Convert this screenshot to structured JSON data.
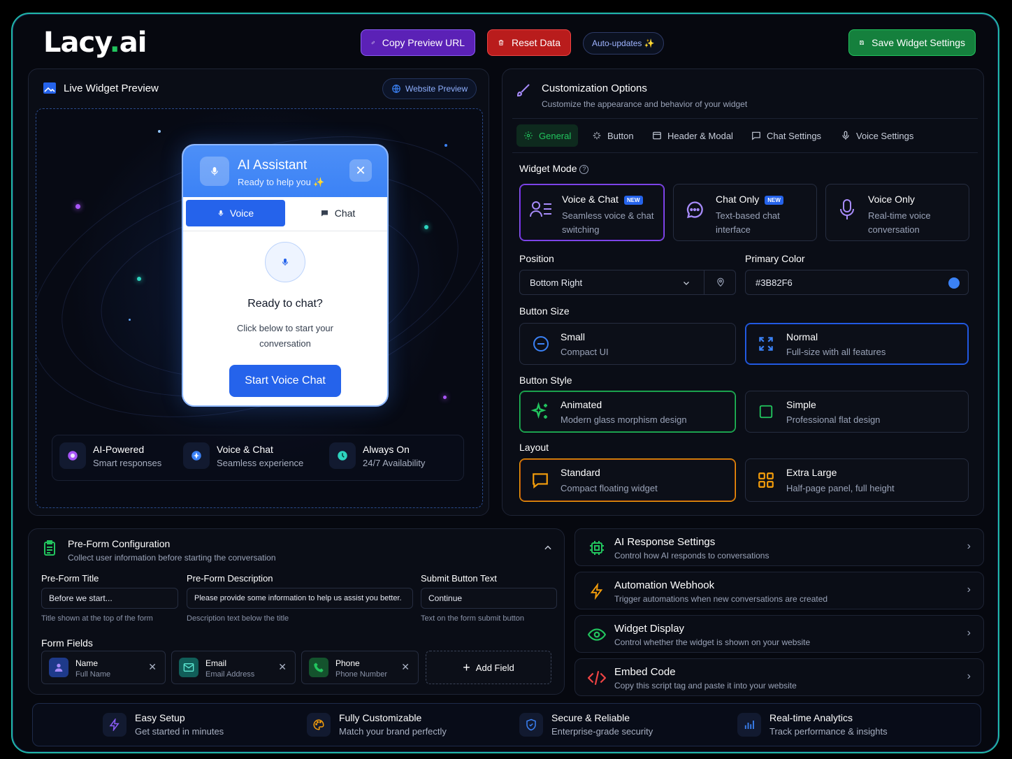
{
  "brand": {
    "logo_main": "Lacy",
    "logo_dot": ".",
    "logo_end": "ai"
  },
  "toolbar": {
    "copy_url": "Copy Preview URL",
    "reset": "Reset Data",
    "auto_updates": "Auto-updates ✨",
    "save": "Save Widget Settings"
  },
  "preview": {
    "title": "Live Widget Preview",
    "website_preview": "Website Preview",
    "widget": {
      "title": "AI Assistant",
      "subtitle": "Ready to help you ✨",
      "tab_voice": "Voice",
      "tab_chat": "Chat",
      "heading": "Ready to chat?",
      "body": "Click below to start your conversation",
      "cta": "Start Voice Chat"
    },
    "features": [
      {
        "title": "AI-Powered",
        "sub": "Smart responses"
      },
      {
        "title": "Voice & Chat",
        "sub": "Seamless experience"
      },
      {
        "title": "Always On",
        "sub": "24/7 Availability"
      }
    ]
  },
  "customization": {
    "title": "Customization Options",
    "subtitle": "Customize the appearance and behavior of your widget",
    "tabs": [
      "General",
      "Button",
      "Header & Modal",
      "Chat Settings",
      "Voice Settings"
    ],
    "widget_mode_label": "Widget Mode",
    "modes": [
      {
        "title": "Voice & Chat",
        "badge": "NEW",
        "sub1": "Seamless voice & chat",
        "sub2": "switching"
      },
      {
        "title": "Chat Only",
        "badge": "NEW",
        "sub1": "Text-based chat",
        "sub2": "interface"
      },
      {
        "title": "Voice Only",
        "sub1": "Real-time voice",
        "sub2": "conversation"
      }
    ],
    "position_label": "Position",
    "position_value": "Bottom Right",
    "color_label": "Primary Color",
    "color_value": "#3B82F6",
    "button_size_label": "Button Size",
    "sizes": [
      {
        "title": "Small",
        "sub": "Compact UI"
      },
      {
        "title": "Normal",
        "sub": "Full-size with all features"
      }
    ],
    "button_style_label": "Button Style",
    "styles": [
      {
        "title": "Animated",
        "sub": "Modern glass morphism design"
      },
      {
        "title": "Simple",
        "sub": "Professional flat design"
      }
    ],
    "layout_label": "Layout",
    "layouts": [
      {
        "title": "Standard",
        "sub": "Compact floating widget"
      },
      {
        "title": "Extra Large",
        "sub": "Half-page panel, full height"
      }
    ]
  },
  "preform": {
    "title": "Pre-Form Configuration",
    "subtitle": "Collect user information before starting the conversation",
    "title_label": "Pre-Form Title",
    "title_value": "Before we start...",
    "title_hint": "Title shown at the top of the form",
    "desc_label": "Pre-Form Description",
    "desc_value": "Please provide some information to help us assist you better.",
    "desc_hint": "Description text below the title",
    "submit_label": "Submit Button Text",
    "submit_value": "Continue",
    "submit_hint": "Text on the form submit button",
    "fields_label": "Form Fields",
    "fields": [
      {
        "name": "Name",
        "label": "Full Name"
      },
      {
        "name": "Email",
        "label": "Email Address"
      },
      {
        "name": "Phone",
        "label": "Phone Number"
      }
    ],
    "add_field": "Add Field"
  },
  "sections": [
    {
      "title": "AI Response Settings",
      "sub": "Control how AI responds to conversations"
    },
    {
      "title": "Automation Webhook",
      "sub": "Trigger automations when new conversations are created"
    },
    {
      "title": "Widget Display",
      "sub": "Control whether the widget is shown on your website"
    },
    {
      "title": "Embed Code",
      "sub": "Copy this script tag and paste it into your website"
    }
  ],
  "footer": [
    {
      "title": "Easy Setup",
      "sub": "Get started in minutes"
    },
    {
      "title": "Fully Customizable",
      "sub": "Match your brand perfectly"
    },
    {
      "title": "Secure & Reliable",
      "sub": "Enterprise-grade security"
    },
    {
      "title": "Real-time Analytics",
      "sub": "Track performance & insights"
    }
  ],
  "colors": {
    "accent_green": "#22C55E",
    "accent_blue": "#3B82F6",
    "accent_purple": "#8B5CF6",
    "accent_orange": "#F59E0B"
  }
}
